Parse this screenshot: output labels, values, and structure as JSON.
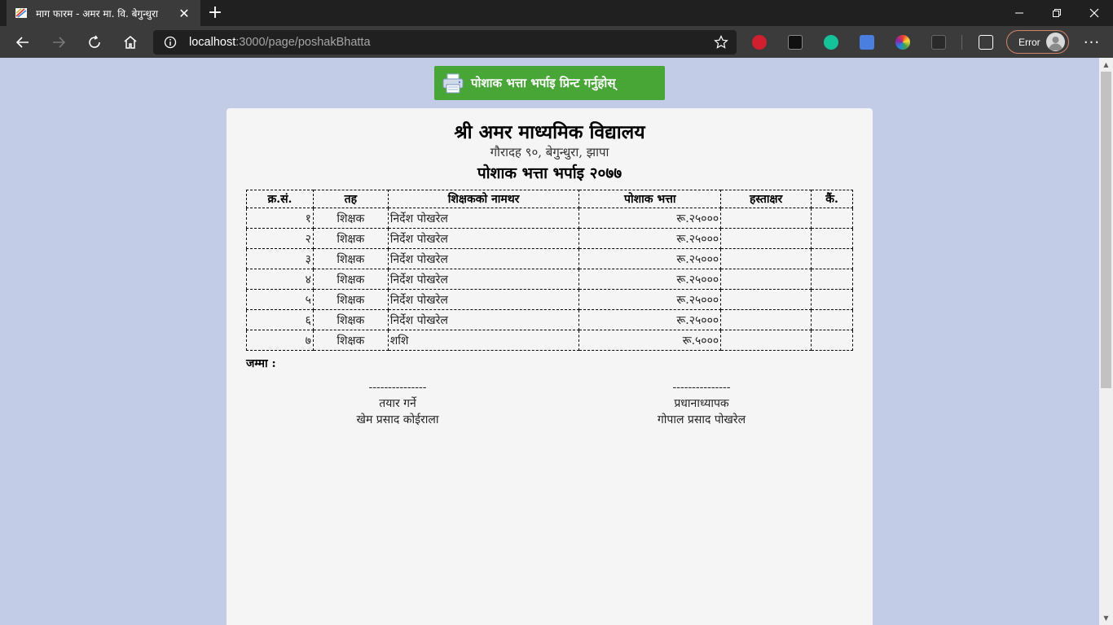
{
  "browser": {
    "tab_title": "माग फारम - अमर मा. वि. बेगुन्धुरा",
    "url_host": "localhost",
    "url_path": ":3000/page/poshakBhatta",
    "profile_label": "Error"
  },
  "page": {
    "print_button_label": "पोशाक भत्ता भर्पाइ प्रिन्ट गर्नुहोस्",
    "school_name": "श्री अमर माध्यमिक विद्यालय",
    "school_address": "गौरादह ९०, बेगुन्धुरा, झापा",
    "document_title": "पोशाक भत्ता भर्पाइ २०७७",
    "table": {
      "headers": [
        "क्र.सं.",
        "तह",
        "शिक्षकको  नामथर",
        "पोशाक  भत्ता",
        "हस्ताक्षर",
        "कैं."
      ],
      "rows": [
        {
          "sn": "१",
          "level": "शिक्षक",
          "name": "निर्देश पोखरेल",
          "amount": "रू.२५०००"
        },
        {
          "sn": "२",
          "level": "शिक्षक",
          "name": "निर्देश पोखरेल",
          "amount": "रू.२५०००"
        },
        {
          "sn": "३",
          "level": "शिक्षक",
          "name": "निर्देश पोखरेल",
          "amount": "रू.२५०००"
        },
        {
          "sn": "४",
          "level": "शिक्षक",
          "name": "निर्देश पोखरेल",
          "amount": "रू.२५०००"
        },
        {
          "sn": "५",
          "level": "शिक्षक",
          "name": "निर्देश पोखरेल",
          "amount": "रू.२५०००"
        },
        {
          "sn": "६",
          "level": "शिक्षक",
          "name": "निर्देश पोखरेल",
          "amount": "रू.२५०००"
        },
        {
          "sn": "७",
          "level": "शिक्षक",
          "name": "शशि",
          "amount": "रू.५०००"
        }
      ]
    },
    "total_label": "जम्मा :",
    "preparer": {
      "line": "---------------",
      "role": "तयार गर्ने",
      "name": "खेम प्रसाद कोईराला"
    },
    "principal": {
      "line": "---------------",
      "role": "प्रधानाध्यापक",
      "name": "गोपाल प्रसाद पोखरेल"
    }
  },
  "colors": {
    "page_background": "#c3cce6",
    "print_button": "#47a636",
    "paper": "#f5f5f5"
  },
  "icons": [
    "favicon-icon",
    "close-icon",
    "new-tab-icon",
    "back-icon",
    "forward-icon",
    "refresh-icon",
    "home-icon",
    "info-icon",
    "star-icon",
    "printer-icon",
    "more-icon"
  ]
}
